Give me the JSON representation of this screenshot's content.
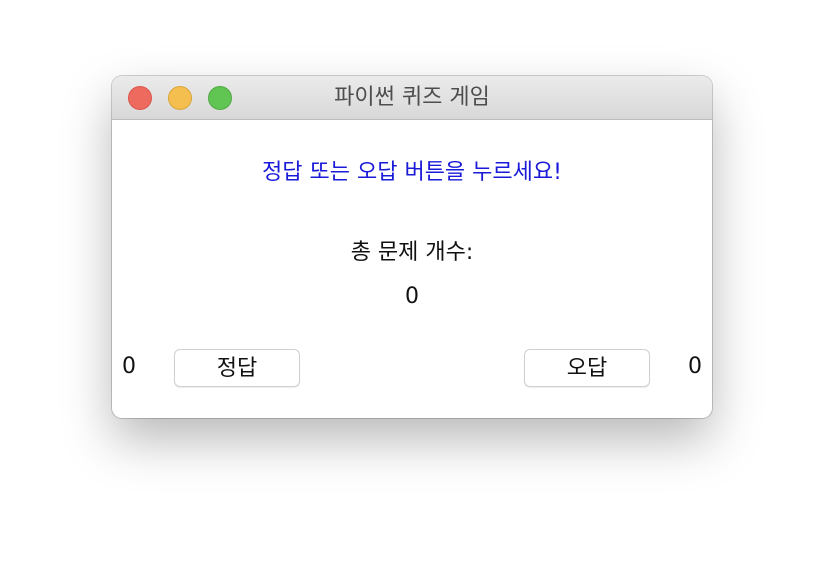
{
  "window": {
    "title": "파이썬 퀴즈 게임"
  },
  "instruction": "정답 또는 오답 버튼을 누르세요!",
  "total": {
    "label": "총 문제 개수:",
    "value": "0"
  },
  "correct": {
    "button_label": "정답",
    "count": "0"
  },
  "wrong": {
    "button_label": "오답",
    "count": "0"
  },
  "colors": {
    "instruction_text": "#1a1ad9",
    "close": "#ee6a5f",
    "minimize": "#f5bf4f",
    "maximize": "#61c554"
  }
}
